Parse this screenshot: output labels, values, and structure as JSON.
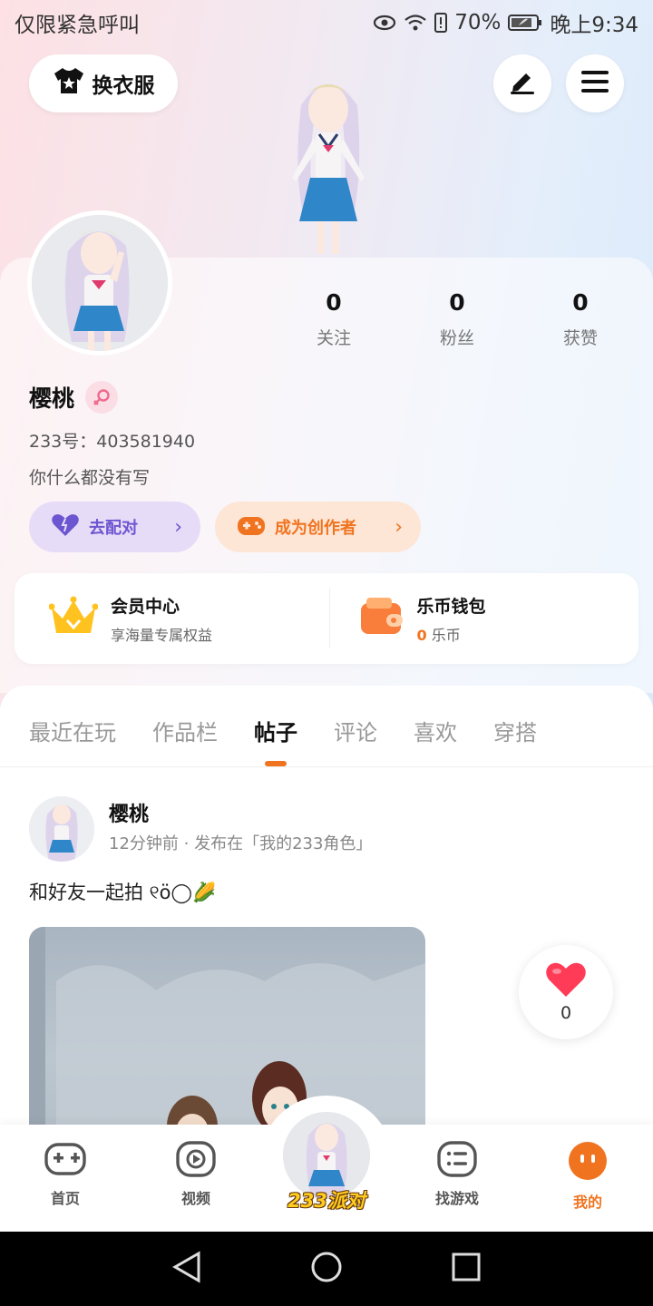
{
  "status_bar": {
    "carrier": "仅限紧急呼叫",
    "battery": "70%",
    "time": "晚上9:34"
  },
  "header": {
    "outfit_label": "换衣服",
    "edit_icon": "pencil-icon",
    "menu_icon": "hamburger-icon"
  },
  "profile": {
    "stats": [
      {
        "value": "0",
        "label": "关注"
      },
      {
        "value": "0",
        "label": "粉丝"
      },
      {
        "value": "0",
        "label": "获赞"
      }
    ],
    "name": "樱桃",
    "gender": "female",
    "uid": "233号：403581940",
    "bio": "你什么都没有写",
    "match_label": "去配对",
    "creator_label": "成为创作者"
  },
  "member_wallet": {
    "member_title": "会员中心",
    "member_sub": "享海量专属权益",
    "wallet_title": "乐币钱包",
    "wallet_amount": "0",
    "wallet_unit": "乐币"
  },
  "tabs": [
    "最近在玩",
    "作品栏",
    "帖子",
    "评论",
    "喜欢",
    "穿搭"
  ],
  "active_tab": "帖子",
  "post": {
    "author": "樱桃",
    "meta": "12分钟前 · 发布在「我的233角色」",
    "text": "和好友一起拍 ୧ö◯🌽",
    "like_count": "0"
  },
  "bottom_nav": {
    "items": [
      {
        "label": "首页",
        "icon": "gamepad-icon"
      },
      {
        "label": "视频",
        "icon": "play-icon"
      },
      {
        "label": "233派对",
        "icon": "avatar-icon"
      },
      {
        "label": "找游戏",
        "icon": "list-icon"
      },
      {
        "label": "我的",
        "icon": "face-icon"
      }
    ]
  },
  "colors": {
    "accent": "#f07420",
    "match": "#6c55d0",
    "heart": "#ff3b57"
  }
}
